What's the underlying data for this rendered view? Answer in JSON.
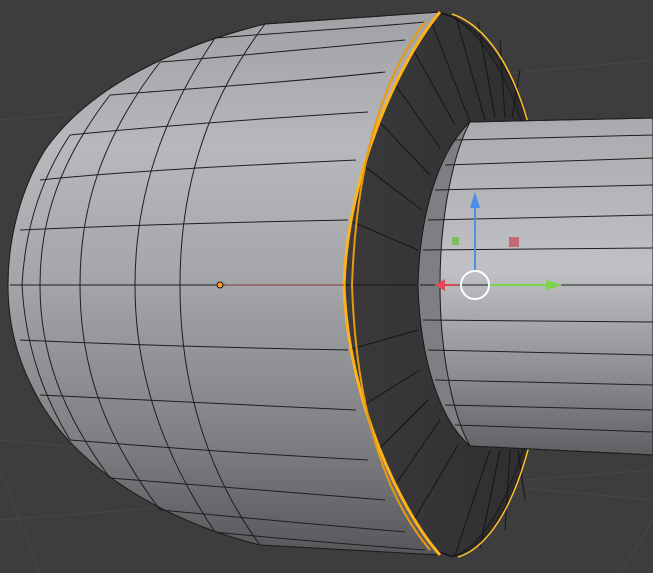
{
  "viewport": {
    "mode": "Edit Mode",
    "selection": "edge-loop"
  },
  "colors": {
    "background": "#3d3d3d",
    "grid_line": "#4a4a4a",
    "mesh_face_light": "#b4b6b9",
    "mesh_face_dark": "#5b5d60",
    "mesh_inner": "#39393b",
    "wire": "#1a1a1a",
    "selected_edge": "#ffb21a",
    "x_axis": "#e0485a",
    "y_axis": "#7bd34e",
    "z_axis": "#4a8fe8",
    "origin_dot": "#ff9c1a",
    "gizmo_circle": "#ffffff"
  },
  "gizmo": {
    "tool": "move",
    "axes": [
      "x",
      "y",
      "z"
    ],
    "plane_handles": [
      "yz-plane",
      "xz-plane"
    ]
  }
}
